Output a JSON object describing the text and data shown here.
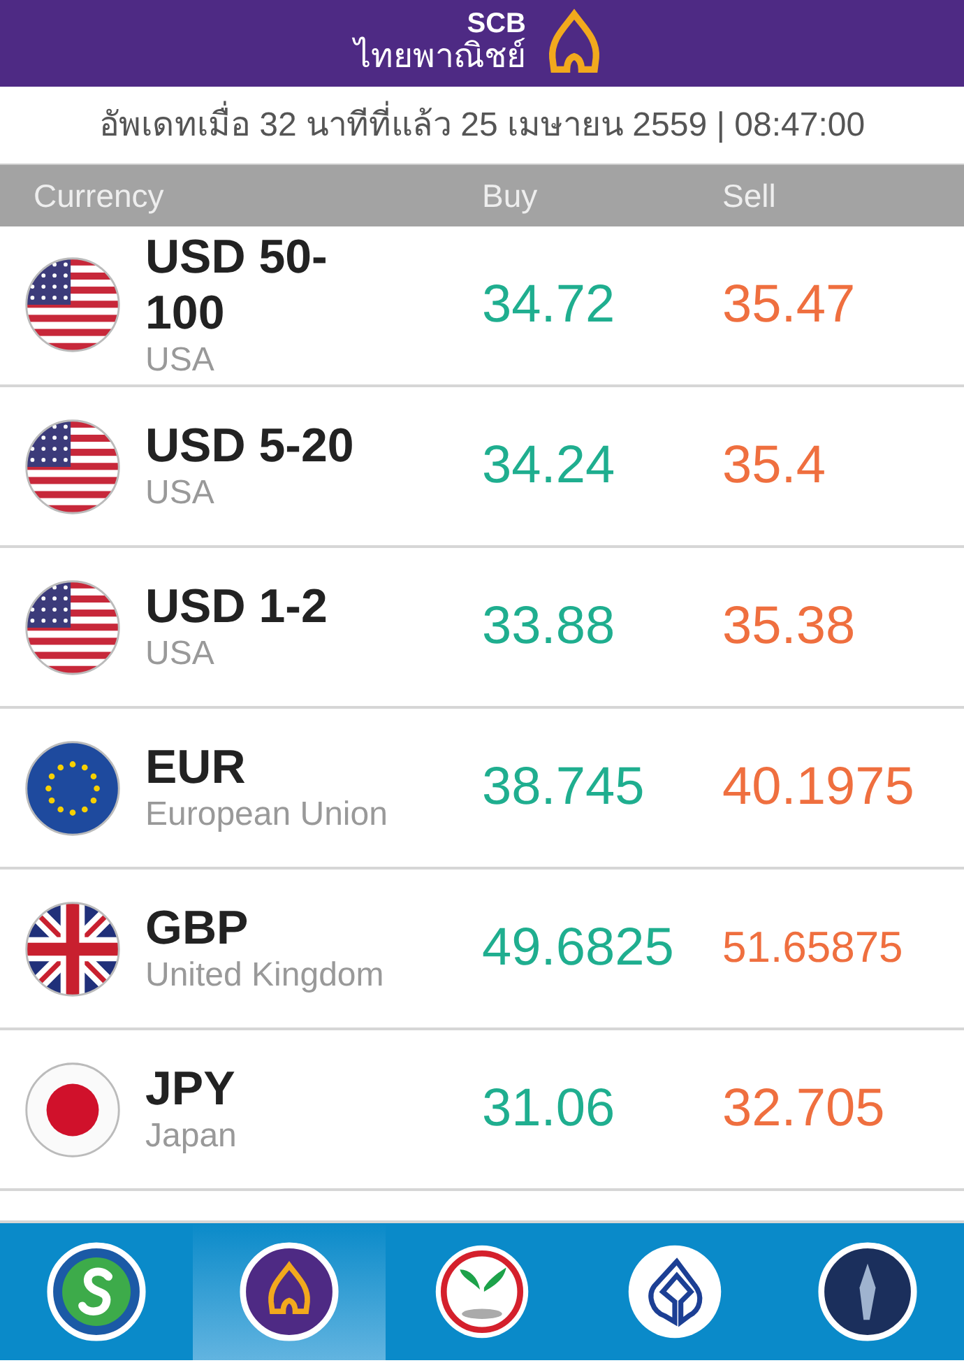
{
  "header": {
    "brand": "SCB",
    "brand_thai": "ไทยพาณิชย์"
  },
  "update_line": "อัพเดทเมื่อ 32 นาทีที่แล้ว 25 เมษายน 2559 | 08:47:00",
  "columns": [
    "Currency",
    "Buy",
    "Sell"
  ],
  "rates": [
    {
      "kind": "us",
      "code": "USD 50-100",
      "country": "USA",
      "buy": "34.72",
      "sell": "35.47"
    },
    {
      "kind": "us",
      "code": "USD 5-20",
      "country": "USA",
      "buy": "34.24",
      "sell": "35.4"
    },
    {
      "kind": "us",
      "code": "USD 1-2",
      "country": "USA",
      "buy": "33.88",
      "sell": "35.38"
    },
    {
      "kind": "eu",
      "code": "EUR",
      "country": "European Union",
      "buy": "38.745",
      "sell": "40.1975"
    },
    {
      "kind": "gb",
      "code": "GBP",
      "country": "United Kingdom",
      "buy": "49.6825",
      "sell": "51.65875"
    },
    {
      "kind": "jp",
      "code": "JPY",
      "country": "Japan",
      "buy": "31.06",
      "sell": "32.705"
    }
  ],
  "bank_tabs": [
    {
      "kind": "green-s",
      "selected": false
    },
    {
      "kind": "purple-arch",
      "selected": true
    },
    {
      "kind": "red-leaf",
      "selected": false
    },
    {
      "kind": "blue-leaf",
      "selected": false
    },
    {
      "kind": "navy",
      "selected": false
    }
  ]
}
